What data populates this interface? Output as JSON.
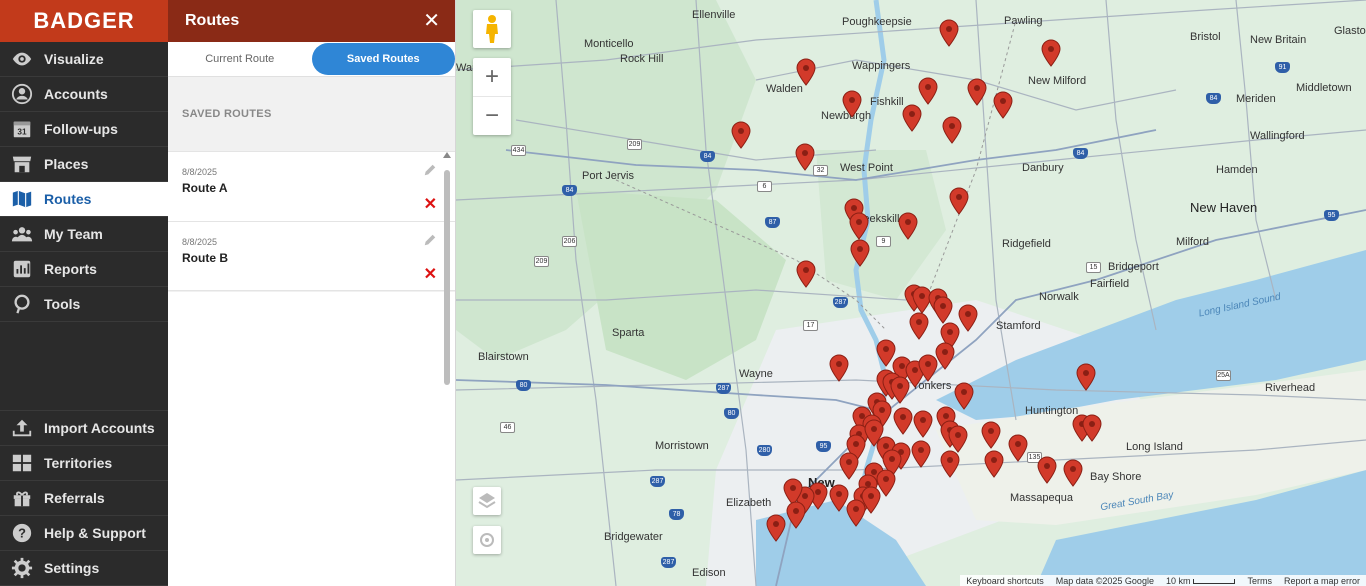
{
  "app": {
    "logo": "BADGER"
  },
  "nav": {
    "items": [
      {
        "label": "Visualize",
        "icon": "eye-icon"
      },
      {
        "label": "Accounts",
        "icon": "user-icon"
      },
      {
        "label": "Follow-ups",
        "icon": "calendar-icon",
        "badge": "31"
      },
      {
        "label": "Places",
        "icon": "store-icon"
      },
      {
        "label": "Routes",
        "icon": "map-icon",
        "active": true
      },
      {
        "label": "My Team",
        "icon": "team-icon"
      },
      {
        "label": "Reports",
        "icon": "chart-icon"
      },
      {
        "label": "Tools",
        "icon": "speech-icon"
      }
    ],
    "bottom": [
      {
        "label": "Import Accounts",
        "icon": "upload-icon"
      },
      {
        "label": "Territories",
        "icon": "grid-icon"
      },
      {
        "label": "Referrals",
        "icon": "gift-icon"
      },
      {
        "label": "Help & Support",
        "icon": "question-icon"
      },
      {
        "label": "Settings",
        "icon": "gear-icon"
      }
    ]
  },
  "panel": {
    "title": "Routes",
    "close": "✕",
    "tabs": [
      {
        "label": "Current Route"
      },
      {
        "label": "Saved Routes",
        "active": true
      }
    ],
    "section_label": "SAVED ROUTES",
    "routes": [
      {
        "date": "8/8/2025",
        "name": "Route A"
      },
      {
        "date": "8/8/2025",
        "name": "Route B"
      }
    ]
  },
  "map": {
    "labels": [
      "Ellenville",
      "Monticello",
      "Rock Hill",
      "Warwick",
      "Poughkeepsie",
      "Walden",
      "Newburgh",
      "Fishkill",
      "Port Jervis",
      "West Point",
      "Danbury",
      "New Milford",
      "Bristol",
      "New Britain",
      "Glaston",
      "Meriden",
      "Middletown",
      "Wallingford",
      "Hamden",
      "New Haven",
      "Milford",
      "Ridgefield",
      "Bridgeport",
      "Fairfield",
      "Norwalk",
      "Stamford",
      "Peekskill",
      "Sparta",
      "Blairstown",
      "Wayne",
      "Morristown",
      "Huntington",
      "Riverhead",
      "Long Island",
      "Bay Shore",
      "Massapequa",
      "Elizabeth",
      "Bridgewater",
      "Edison",
      "New",
      "Long Island Sound",
      "Great South Bay",
      "Pawling",
      "Wappingers",
      "Yonkers"
    ],
    "shields": [
      "209",
      "84",
      "434",
      "6",
      "84",
      "32",
      "87",
      "9",
      "206",
      "209",
      "287",
      "17",
      "80",
      "287",
      "80",
      "46",
      "78",
      "287",
      "287",
      "95",
      "280",
      "135",
      "25A",
      "91",
      "84",
      "84",
      "15",
      "95"
    ],
    "controls": {
      "zoom_in": "+",
      "zoom_out": "−"
    },
    "footer": {
      "shortcuts": "Keyboard shortcuts",
      "data": "Map data ©2025 Google",
      "scale": "10 km",
      "terms": "Terms",
      "report": "Report a map error"
    }
  },
  "colors": {
    "brand": "#c23a1b",
    "panel_header": "#8a2a16",
    "accent": "#2f86d6",
    "pin": "#d23a2a"
  }
}
